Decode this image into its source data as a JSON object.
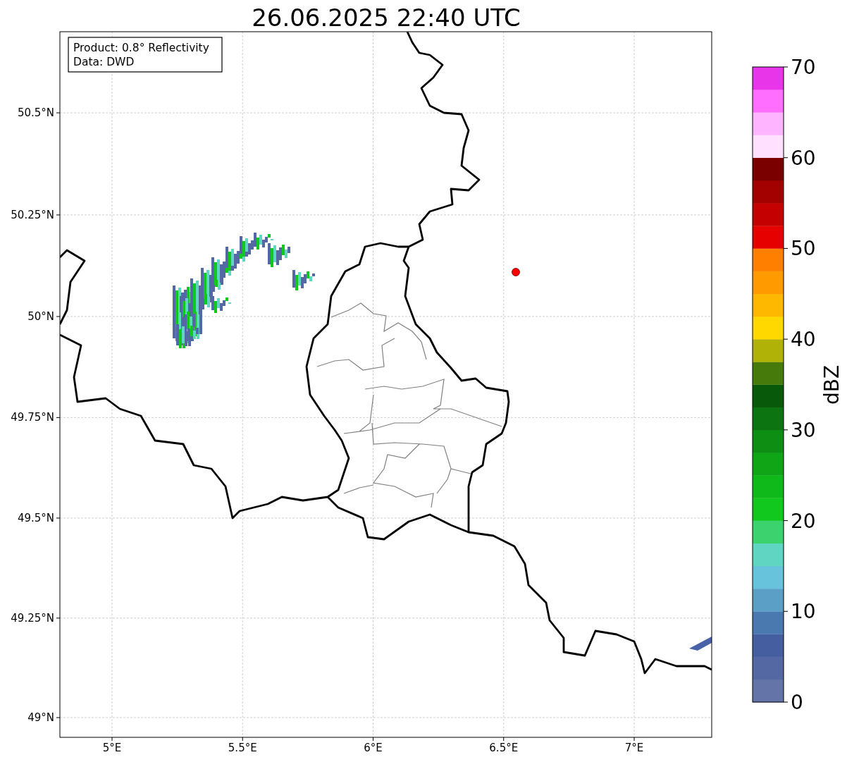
{
  "title": "26.06.2025 22:40 UTC",
  "legend": {
    "lines": [
      "Product: 0.8° Reflectivity",
      "Data: DWD"
    ]
  },
  "map": {
    "x_ticks": [
      "5°E",
      "5.5°E",
      "6°E",
      "6.5°E",
      "7°E"
    ],
    "y_ticks": [
      "50.5°N",
      "50.25°N",
      "50°N",
      "49.75°N",
      "49.5°N",
      "49.25°N",
      "49°N"
    ]
  },
  "colorbar": {
    "label": "dBZ",
    "ticks": [
      "70",
      "60",
      "50",
      "40",
      "30",
      "20",
      "10",
      "0"
    ],
    "bins": [
      {
        "color": "#6473a8"
      },
      {
        "color": "#5468a3"
      },
      {
        "color": "#445ea0"
      },
      {
        "color": "#4a79b0"
      },
      {
        "color": "#5b9ec6"
      },
      {
        "color": "#67c2dc"
      },
      {
        "color": "#60d6c2"
      },
      {
        "color": "#3cd26e"
      },
      {
        "color": "#11c91e"
      },
      {
        "color": "#10b91a"
      },
      {
        "color": "#10a516"
      },
      {
        "color": "#0e8f14"
      },
      {
        "color": "#0c7410"
      },
      {
        "color": "#085a0a"
      },
      {
        "color": "#467a0a"
      },
      {
        "color": "#b0b208"
      },
      {
        "color": "#ffd800"
      },
      {
        "color": "#ffb800"
      },
      {
        "color": "#ff9b00"
      },
      {
        "color": "#ff8000"
      },
      {
        "color": "#e60000"
      },
      {
        "color": "#c40000"
      },
      {
        "color": "#a30000"
      },
      {
        "color": "#7a0000"
      },
      {
        "color": "#ffe0ff"
      },
      {
        "color": "#ffb4ff"
      },
      {
        "color": "#ff6eff"
      },
      {
        "color": "#e935e9"
      }
    ]
  }
}
